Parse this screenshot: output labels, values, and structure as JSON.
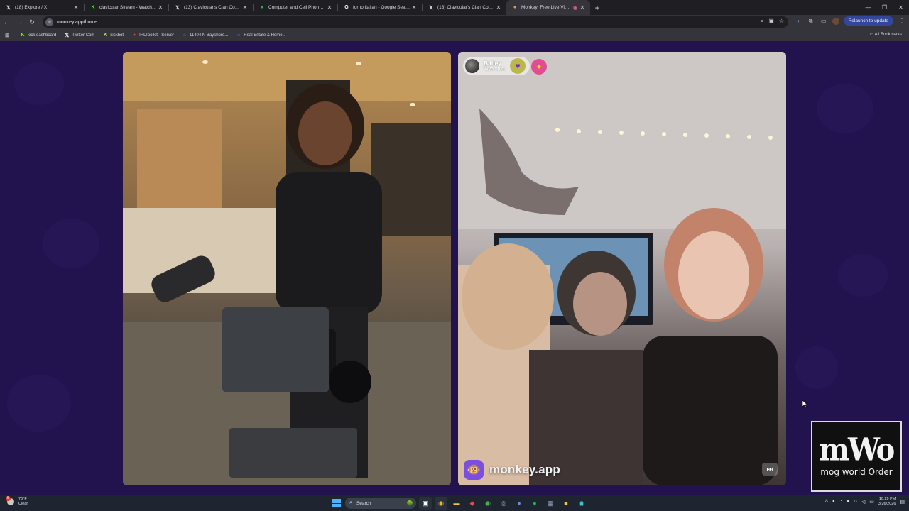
{
  "browser": {
    "tabs": [
      {
        "label": "(18) Explore / X",
        "icon": "x-icon",
        "color": "#ffffff"
      },
      {
        "label": "clavicular Stream - Watch Live",
        "icon": "kick-icon",
        "color": "#53fc18"
      },
      {
        "label": "(13) Clavicular's Clan Communi",
        "icon": "x-icon",
        "color": "#ffffff"
      },
      {
        "label": "Computer and Cell Phone Store",
        "icon": "map-pin-icon",
        "color": "#34a853"
      },
      {
        "label": "forno italian - Google Search",
        "icon": "google-icon",
        "color": "#ffffff"
      },
      {
        "label": "(13) Clavicular's Clan Communi",
        "icon": "x-icon",
        "color": "#ffffff"
      },
      {
        "label": "Monkey: Free Live Video Ch",
        "icon": "monkey-icon",
        "color": "#c8a45a",
        "active": true
      }
    ],
    "new_tab": "+",
    "url": "monkey.app/home",
    "relaunch_label": "Relaunch to update",
    "bookmarks": [
      {
        "label": "kick dashboard",
        "icon": "kick-icon",
        "color": "#53fc18"
      },
      {
        "label": "Twitter Com",
        "icon": "x-icon",
        "color": "#ffffff"
      },
      {
        "label": "kickbot",
        "icon": "kickbot-icon",
        "color": "#c8e04a"
      },
      {
        "label": "IRLToolkit - Server",
        "icon": "irl-icon",
        "color": "#e0443c"
      },
      {
        "label": "11404 N Bayshore...",
        "icon": "zillow-icon",
        "color": "#2a7bff"
      },
      {
        "label": "Real Estate & Home...",
        "icon": "zillow-icon",
        "color": "#2a7bff"
      }
    ],
    "all_bookmarks": "All Bookmarks"
  },
  "chat": {
    "partner_name": "Bailey",
    "partner_location": "Wyoming",
    "brand": "monkey.app"
  },
  "overlay": {
    "logo": "mWo",
    "tagline": "mog world Order"
  },
  "taskbar": {
    "temp": "76°F",
    "condition": "Clear",
    "badge": "5",
    "search_placeholder": "Search",
    "time": "10:29 PM",
    "date": "3/26/2026"
  },
  "colors": {
    "page_bg": "#22134f",
    "accent": "#7a4fe0",
    "relaunch": "#33469a"
  }
}
